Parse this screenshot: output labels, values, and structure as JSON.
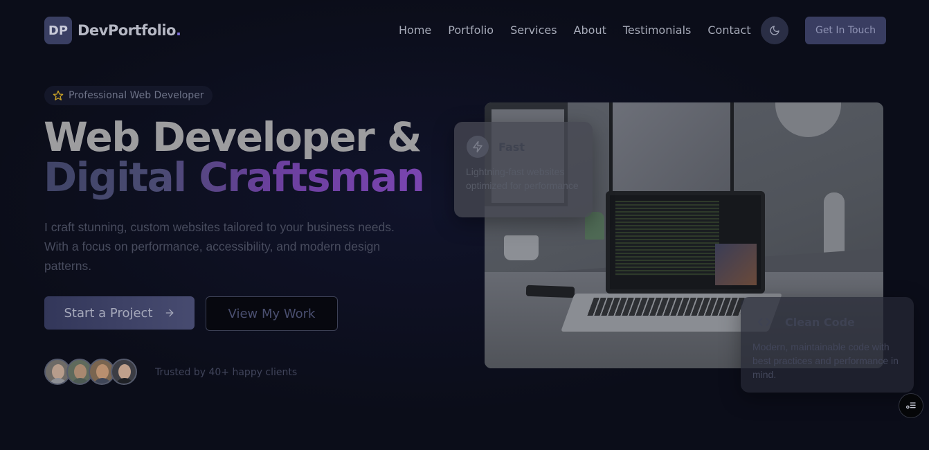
{
  "header": {
    "logo_badge": "DP",
    "logo_text": "DevPortfolio",
    "logo_dot": ".",
    "nav": [
      "Home",
      "Portfolio",
      "Services",
      "About",
      "Testimonials",
      "Contact"
    ],
    "theme_toggle_icon": "moon-icon",
    "cta_label": "Get In Touch"
  },
  "hero": {
    "badge_icon": "star-icon",
    "badge_text": "Professional Web Developer",
    "title_line1": "Web Developer &",
    "title_line2": "Digital Craftsman",
    "lead": "I craft stunning, custom websites tailored to your business needs. With a focus on performance, accessibility, and modern design patterns.",
    "primary_button": "Start a Project",
    "primary_button_icon": "arrow-right-icon",
    "secondary_button": "View My Work",
    "trusted_text": "Trusted by 40+ happy clients"
  },
  "cards": {
    "fast": {
      "icon": "lightning-icon",
      "title": "Fast",
      "desc": "Lightning-fast websites optimized for performance"
    },
    "clean": {
      "icon": "code-icon",
      "title": "Clean Code",
      "desc": "Modern, maintainable code with best practices and performance in mind."
    }
  },
  "colors": {
    "background": "#0b0d19",
    "accent": "#7a45b0",
    "button": "#393d61",
    "star": "#c9a227"
  },
  "fab_icon": "menu-list-icon"
}
